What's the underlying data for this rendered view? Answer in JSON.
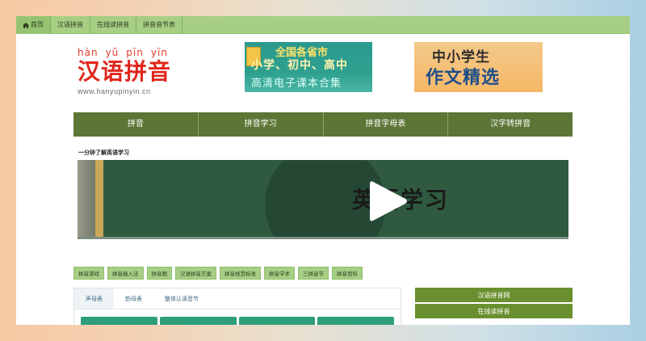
{
  "topnav": {
    "items": [
      {
        "label": "首页",
        "icon": "home-icon"
      },
      {
        "label": "汉语拼音"
      },
      {
        "label": "在线读拼音"
      },
      {
        "label": "拼音音节表"
      }
    ]
  },
  "logo": {
    "pinyin": [
      "hàn",
      "yǔ",
      "pīn",
      "yīn"
    ],
    "title": "汉语拼音",
    "url": "www.hanyupinyin.cn"
  },
  "banner1": {
    "line1": "全国各省市",
    "line2": "小学、初中、高中",
    "line3": "高清电子课本合集"
  },
  "banner2": {
    "line1": "中小学生",
    "line2": "作文精选"
  },
  "mainnav": {
    "items": [
      "拼音",
      "拼音学习",
      "拼音字母表",
      "汉字转拼音"
    ]
  },
  "video": {
    "title": "一分钟了解英语学习",
    "overlay_text": "英语学习",
    "icon": "play-icon"
  },
  "tags": [
    "拼音游戏",
    "拼音输入法",
    "拼音图",
    "汉语拼音方案",
    "拼音规范标准",
    "拼音学术",
    "三拼音节",
    "拼音百科"
  ],
  "panel": {
    "tabs": [
      "声母表",
      "韵母表",
      "整体认读音节"
    ],
    "active_tab": 0
  },
  "sidelist": [
    "汉语拼音网",
    "在线读拼音"
  ],
  "colors": {
    "topnav_bg": "#a6cf83",
    "mainnav_bg": "#5c7636",
    "accent_red": "#e0271c",
    "side_green": "#6a8f2e"
  }
}
